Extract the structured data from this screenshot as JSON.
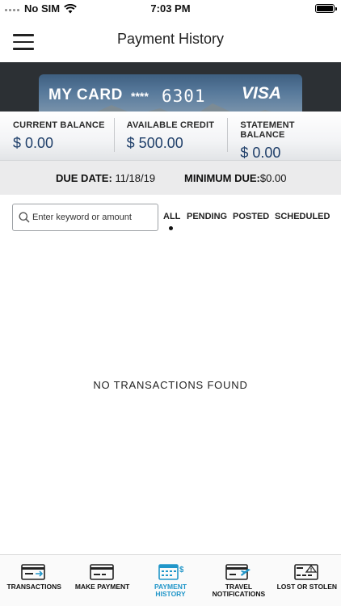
{
  "status_bar": {
    "carrier": "No SIM",
    "time": "7:03 PM",
    "icons": [
      "signal-dots-icon",
      "wifi-icon",
      "battery-icon"
    ]
  },
  "nav": {
    "title": "Payment History",
    "menu_icon": "hamburger-menu-icon"
  },
  "card": {
    "name": "MY CARD",
    "mask": "****",
    "last4": "6301",
    "brand": "VISA"
  },
  "balances": [
    {
      "label": "CURRENT BALANCE",
      "value": "$ 0.00"
    },
    {
      "label": "AVAILABLE CREDIT",
      "value": "$ 500.00"
    },
    {
      "label": "STATEMENT BALANCE",
      "value": "$ 0.00"
    }
  ],
  "due": {
    "due_date_label": "DUE DATE:",
    "due_date_value": "11/18/19",
    "minimum_due_label": "MINIMUM DUE:",
    "minimum_due_value": "$0.00"
  },
  "search": {
    "placeholder": "Enter keyword or amount",
    "value": ""
  },
  "filters": {
    "tabs": [
      "ALL",
      "PENDING",
      "POSTED",
      "SCHEDULED"
    ],
    "selected": "ALL"
  },
  "empty_message": "NO TRANSACTIONS FOUND",
  "tab_bar": {
    "items": [
      {
        "label_line1": "TRANSACTIONS",
        "label_line2": "",
        "icon": "card-transactions-icon"
      },
      {
        "label_line1": "MAKE PAYMENT",
        "label_line2": "",
        "icon": "card-payment-icon"
      },
      {
        "label_line1": "PAYMENT",
        "label_line2": "HISTORY",
        "icon": "calendar-dollar-icon"
      },
      {
        "label_line1": "TRAVEL",
        "label_line2": "NOTIFICATIONS",
        "icon": "card-plane-icon"
      },
      {
        "label_line1": "LOST OR STOLEN",
        "label_line2": "",
        "icon": "card-warning-icon"
      }
    ],
    "active_color": "#2196c9"
  },
  "colors": {
    "balance_value": "#1f3f6a",
    "card_band": "#2c3034",
    "due_row_bg": "#ebebec"
  }
}
